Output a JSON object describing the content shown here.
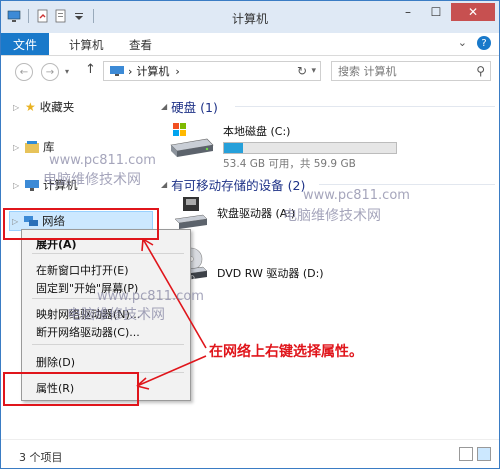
{
  "window": {
    "title": "计算机"
  },
  "ribbon": {
    "file_tab": "文件",
    "tabs": [
      "计算机",
      "查看"
    ]
  },
  "address": {
    "path": "计算机",
    "separator": "›",
    "search_placeholder": "搜索 计算机"
  },
  "nav": {
    "favorites": "收藏夹",
    "libraries": "库",
    "computer": "计算机",
    "network": "网络"
  },
  "content": {
    "hdd_group": "硬盘 (1)",
    "removable_group": "有可移动存储的设备 (2)",
    "drives": [
      {
        "name": "本地磁盘 (C:)",
        "space": "53.4 GB 可用，共 59.9 GB",
        "used_fraction": 0.11
      },
      {
        "name": "软盘驱动器 (A:)"
      },
      {
        "name": "DVD RW 驱动器 (D:)",
        "badge": "DVD"
      }
    ]
  },
  "context_menu": {
    "items": [
      "展开(A)",
      "在新窗口中打开(E)",
      "固定到\"开始\"屏幕(P)",
      "映射网络驱动器(N)...",
      "断开网络驱动器(C)...",
      "删除(D)",
      "属性(R)"
    ]
  },
  "annotation": "在网络上右键选择属性。",
  "watermarks": {
    "url": "www.pc811.com",
    "brand": "电脑维修技术网"
  },
  "status": {
    "count": "3 个项目"
  },
  "colors": {
    "accent": "#1979ca",
    "red": "#e0151b",
    "disk_fill": "#26a0da"
  }
}
